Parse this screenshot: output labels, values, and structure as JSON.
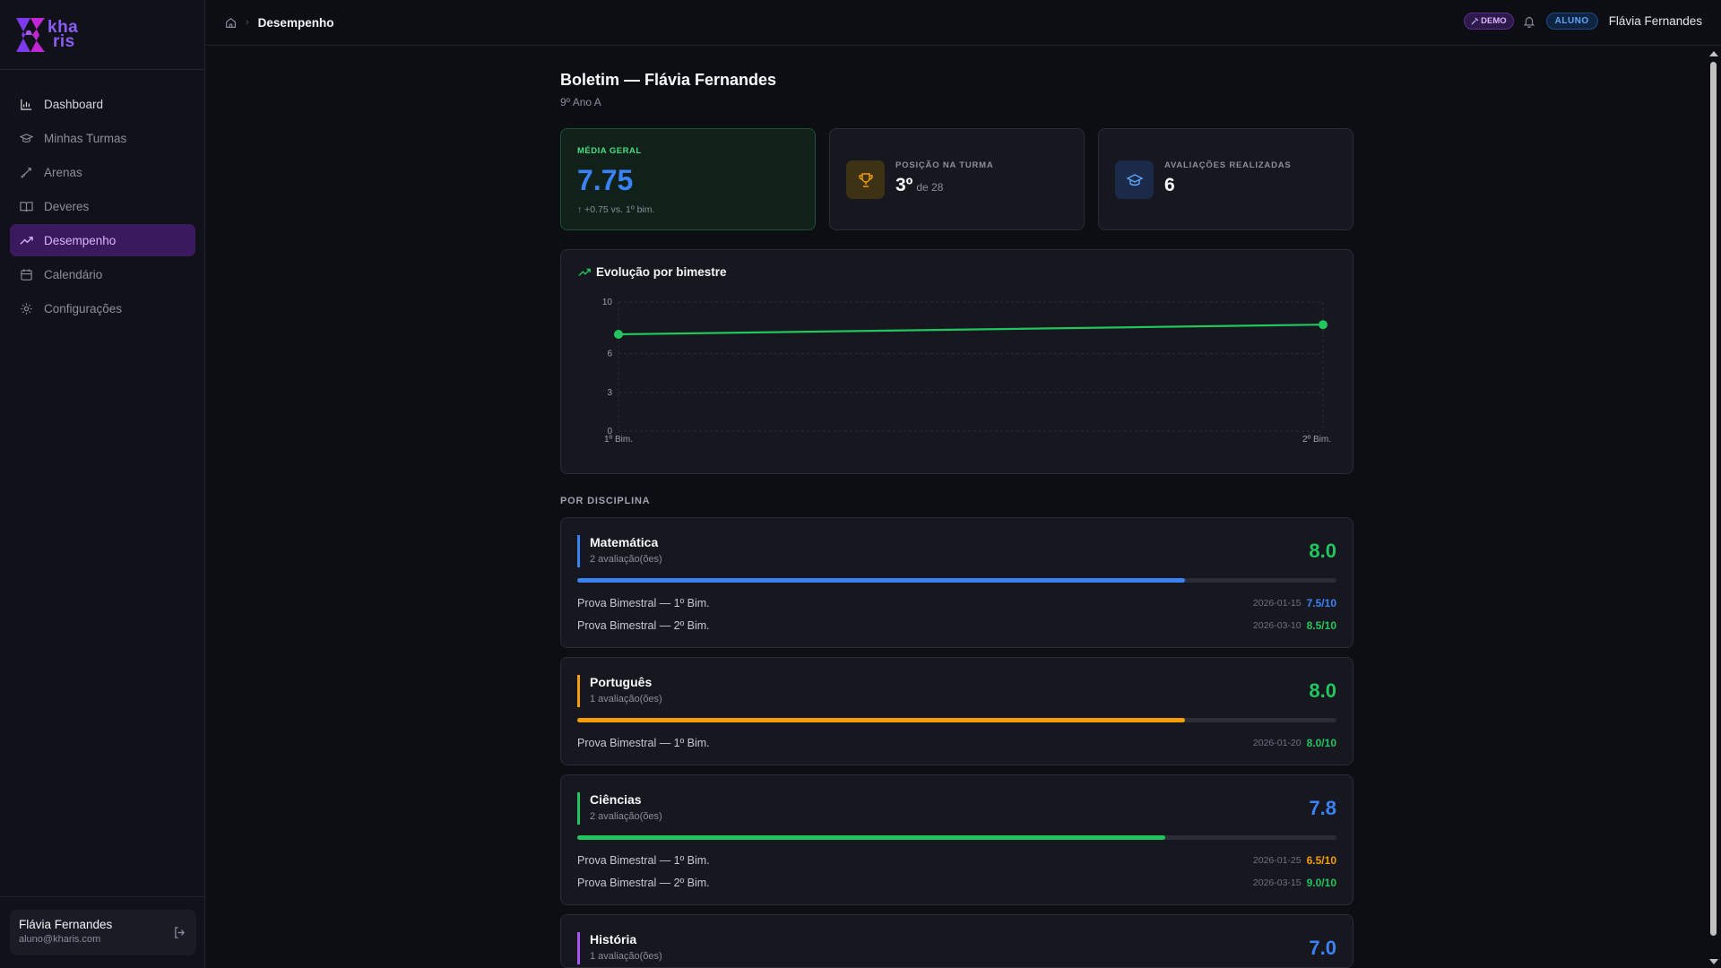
{
  "app": {
    "logo_text_top": "kha",
    "logo_text_bottom": "ris"
  },
  "sidebar": {
    "items": [
      {
        "label": "Dashboard",
        "icon": "bar-chart-icon"
      },
      {
        "label": "Minhas Turmas",
        "icon": "graduation-cap-icon"
      },
      {
        "label": "Arenas",
        "icon": "swords-icon"
      },
      {
        "label": "Deveres",
        "icon": "book-open-icon"
      },
      {
        "label": "Desempenho",
        "icon": "trending-up-icon"
      },
      {
        "label": "Calendário",
        "icon": "calendar-icon"
      },
      {
        "label": "Configurações",
        "icon": "gear-icon"
      }
    ],
    "user": {
      "name": "Flávia Fernandes",
      "email": "aluno@kharis.com"
    }
  },
  "header": {
    "breadcrumb_current": "Desempenho",
    "demo_badge": "DEMO",
    "role_badge": "ALUNO",
    "user_name": "Flávia Fernandes"
  },
  "page": {
    "title": "Boletim — Flávia Fernandes",
    "subtitle": "9º Ano A"
  },
  "stats": {
    "average": {
      "label": "MÉDIA GERAL",
      "value": "7.75",
      "trend": "↑ +0.75 vs. 1º bim."
    },
    "position": {
      "label": "POSIÇÃO NA TURMA",
      "value": "3º",
      "suffix": "de 28"
    },
    "evaluations": {
      "label": "AVALIAÇÕES REALIZADAS",
      "value": "6"
    }
  },
  "chart_data": {
    "type": "line",
    "title": "Evolução por bimestre",
    "categories": [
      "1º Bim.",
      "2º Bim."
    ],
    "series": [
      {
        "values": [
          7.5,
          8.25
        ]
      }
    ],
    "yticks": [
      0,
      3,
      6,
      10
    ],
    "ylim": [
      0,
      10
    ],
    "grid": true,
    "color": "#22c55e"
  },
  "section_label": "POR DISCIPLINA",
  "subjects": [
    {
      "name": "Matemática",
      "count": "2 avaliação(ões)",
      "grade": "8.0",
      "grade_color": "#22c55e",
      "accent": "#3b82f6",
      "progress": 0.8,
      "assessments": [
        {
          "name": "Prova Bimestral — 1º Bim.",
          "date": "2026-01-15",
          "score": "7.5/10",
          "color": "#3b82f6"
        },
        {
          "name": "Prova Bimestral — 2º Bim.",
          "date": "2026-03-10",
          "score": "8.5/10",
          "color": "#22c55e"
        }
      ]
    },
    {
      "name": "Português",
      "count": "1 avaliação(ões)",
      "grade": "8.0",
      "grade_color": "#22c55e",
      "accent": "#f59e0b",
      "progress": 0.8,
      "assessments": [
        {
          "name": "Prova Bimestral — 1º Bim.",
          "date": "2026-01-20",
          "score": "8.0/10",
          "color": "#22c55e"
        }
      ]
    },
    {
      "name": "Ciências",
      "count": "2 avaliação(ões)",
      "grade": "7.8",
      "grade_color": "#3b82f6",
      "accent": "#22c55e",
      "progress": 0.775,
      "assessments": [
        {
          "name": "Prova Bimestral — 1º Bim.",
          "date": "2026-01-25",
          "score": "6.5/10",
          "color": "#f59e0b"
        },
        {
          "name": "Prova Bimestral — 2º Bim.",
          "date": "2026-03-15",
          "score": "9.0/10",
          "color": "#22c55e"
        }
      ]
    },
    {
      "name": "História",
      "count": "1 avaliação(ões)",
      "grade": "7.0",
      "grade_color": "#3b82f6",
      "accent": "#a855f7",
      "progress": 0.7,
      "assessments": []
    }
  ]
}
